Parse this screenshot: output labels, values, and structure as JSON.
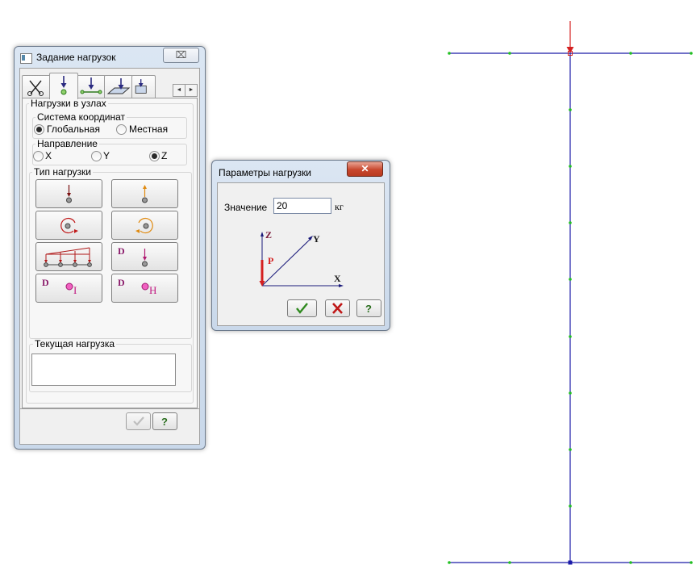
{
  "loads_window": {
    "title": "Задание нагрузок",
    "close_label": "⌧",
    "tabs": [
      {
        "icon": "scissors-icon"
      },
      {
        "icon": "node-load-icon"
      },
      {
        "icon": "bar-load-icon"
      },
      {
        "icon": "plate-load-icon"
      },
      {
        "icon": "solid-load-icon"
      }
    ],
    "tab_scroll": {
      "left": "◄",
      "right": "►"
    },
    "panel_title": "Нагрузки в узлах",
    "coord_system": {
      "label": "Система координат",
      "options": [
        {
          "label": "Глобальная",
          "selected": true
        },
        {
          "label": "Местная",
          "selected": false
        }
      ]
    },
    "direction": {
      "label": "Направление",
      "options": [
        {
          "label": "X",
          "selected": false
        },
        {
          "label": "Y",
          "selected": false
        },
        {
          "label": "Z",
          "selected": true
        }
      ]
    },
    "load_type": {
      "label": "Тип нагрузки",
      "buttons": [
        {
          "icon": "force-down-icon"
        },
        {
          "icon": "force-up-icon"
        },
        {
          "icon": "moment-cw-icon"
        },
        {
          "icon": "moment-ccw-icon"
        },
        {
          "icon": "distributed-load-icon"
        },
        {
          "icon": "dynamic-force-icon",
          "text": "D"
        },
        {
          "icon": "dynamic-i-icon",
          "text": "D",
          "sub": "I"
        },
        {
          "icon": "dynamic-h-icon",
          "text": "D",
          "sub": "H"
        }
      ]
    },
    "current_load": {
      "label": "Текущая нагрузка",
      "value": ""
    },
    "footer": {
      "apply_icon": "checkmark-icon",
      "help_label": "?"
    }
  },
  "params_dialog": {
    "title": "Параметры  нагрузки",
    "close_label": "✕",
    "value_label": "Значение",
    "value": "20",
    "unit": "кг",
    "diagram": {
      "z": "Z",
      "y": "Y",
      "x": "X",
      "p": "P"
    },
    "ok_icon": "checkmark-icon",
    "cancel_icon": "cross-icon",
    "help_label": "?"
  },
  "colors": {
    "frame_line": "#1a1aa8",
    "node": "#22c022",
    "load_arrow": "#d42020",
    "selected_node": "#1a1aa8"
  }
}
